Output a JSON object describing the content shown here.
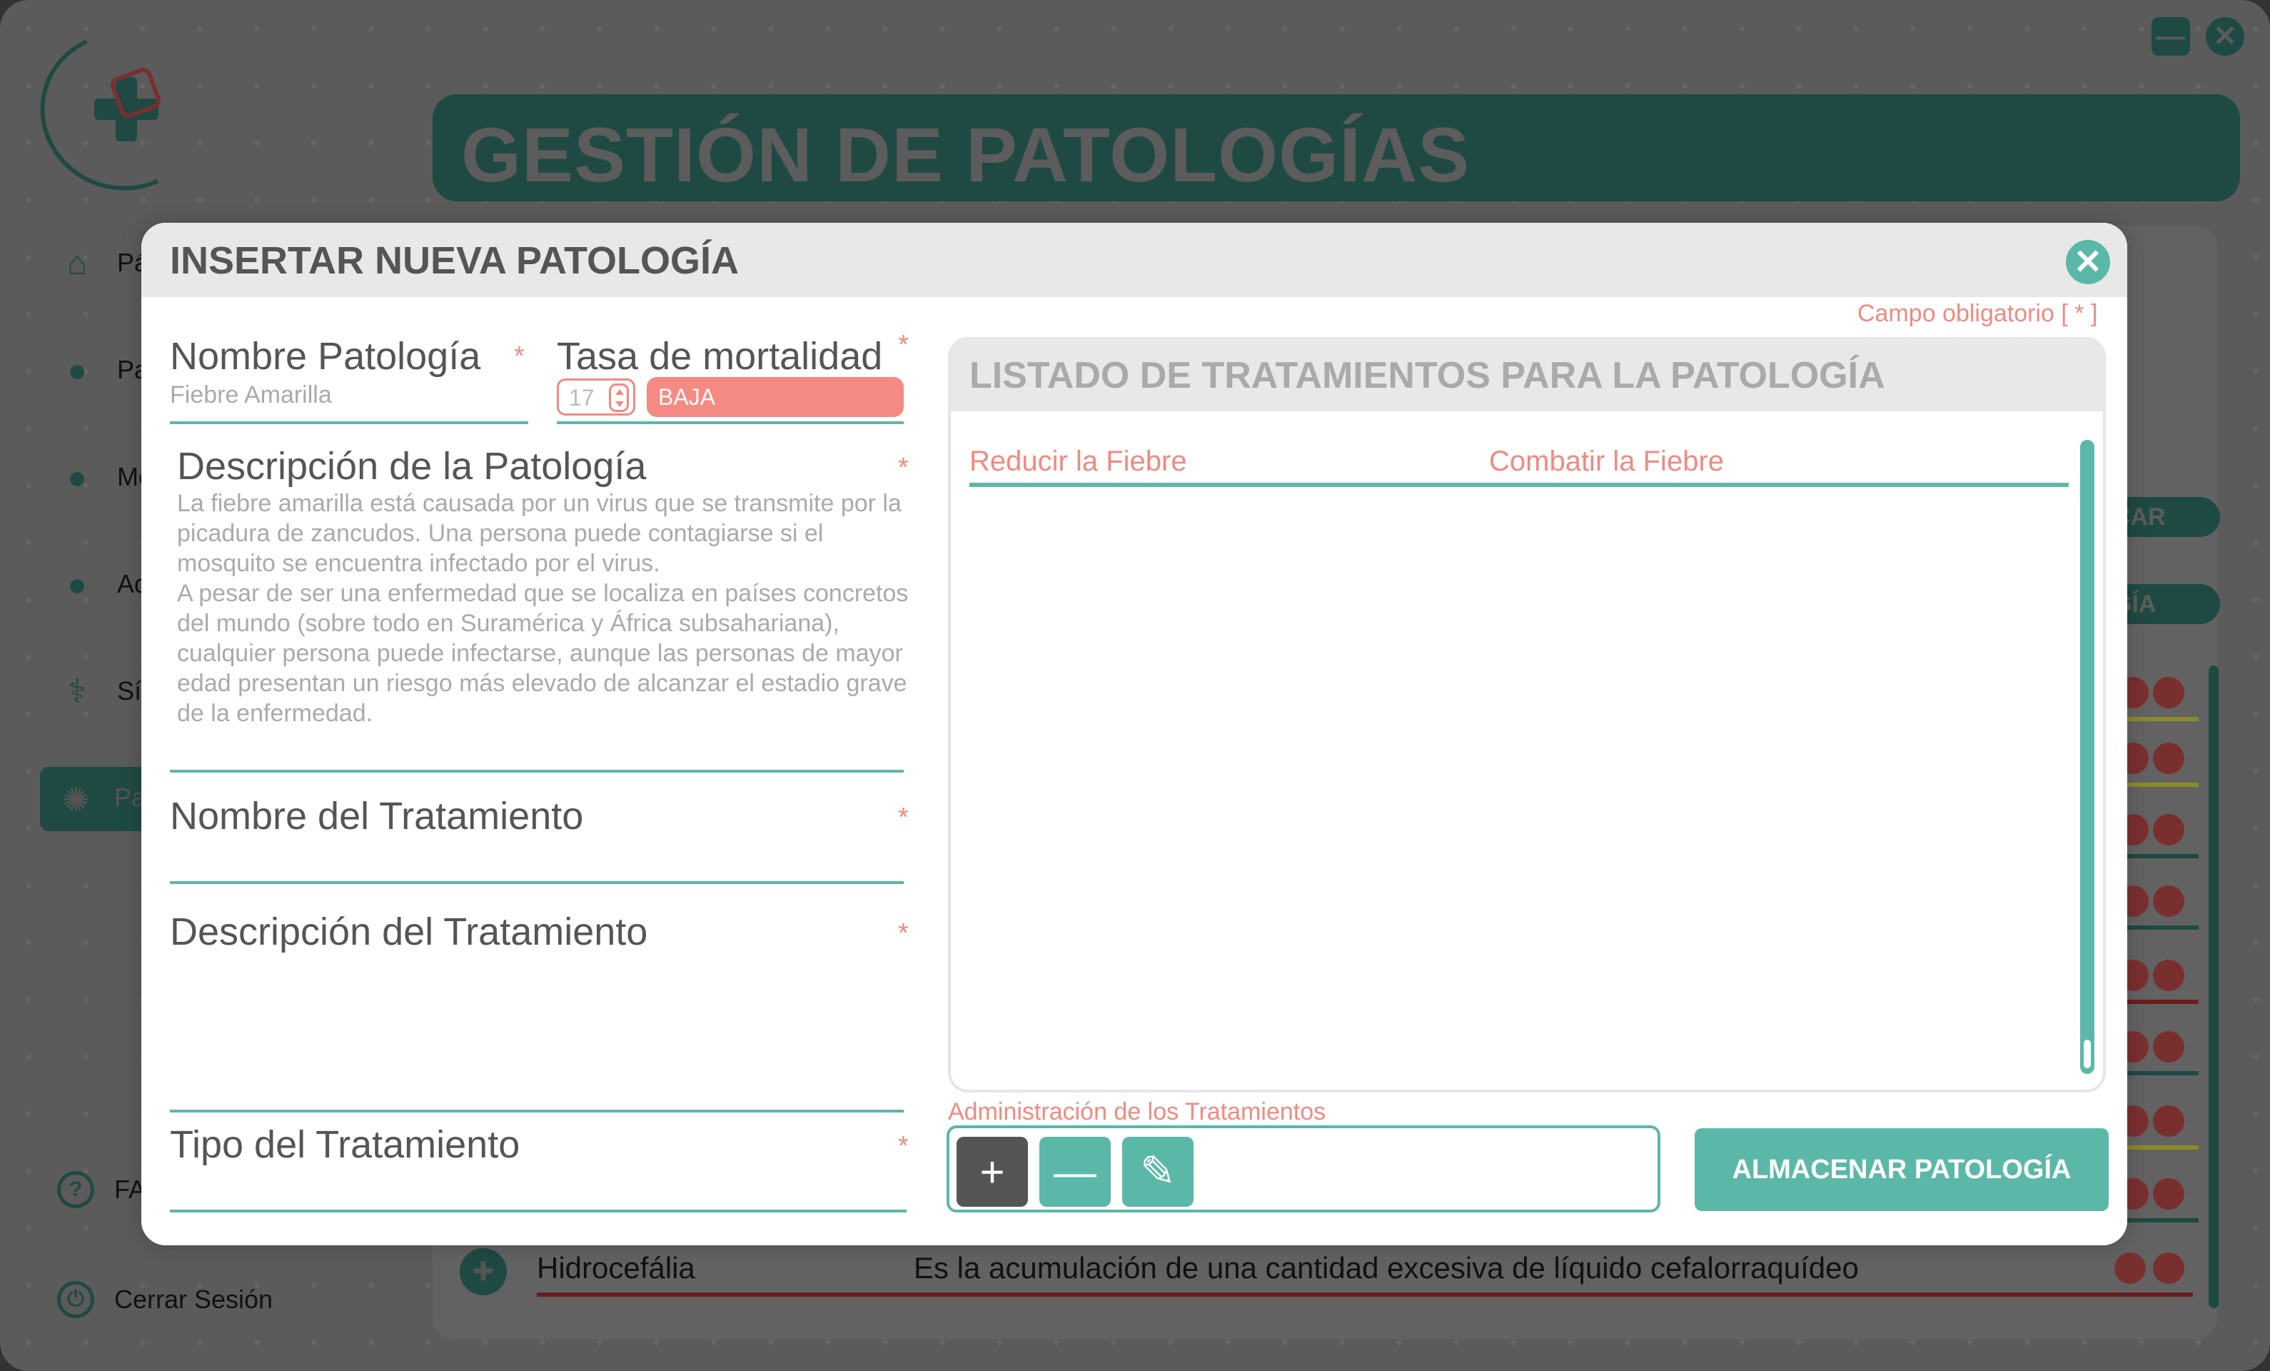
{
  "window": {
    "minimize_icon": "minimize-icon",
    "close_icon": "close-icon"
  },
  "header": {
    "title": "GESTIÓN DE PATOLOGÍAS"
  },
  "sidebar": {
    "items": [
      {
        "label": "Pá",
        "icon": "home-icon"
      },
      {
        "label": "Pa",
        "icon": "user-icon"
      },
      {
        "label": "Me",
        "icon": "user-icon"
      },
      {
        "label": "Ad",
        "icon": "user-icon"
      },
      {
        "label": "Sír",
        "icon": "symptoms-icon"
      },
      {
        "label": "Pa",
        "icon": "virus-icon"
      }
    ],
    "faq": {
      "label": "FA",
      "icon": "help-icon"
    },
    "logout": {
      "label": "Cerrar Sesión",
      "icon": "power-icon"
    }
  },
  "background": {
    "search_chip": "CAR",
    "add_chip": "GÍA",
    "visible_row": {
      "name": "Hidrocefália",
      "description": "Es la acumulación de una cantidad excesiva de líquido cefalorraquídeo"
    }
  },
  "modal": {
    "title": "INSERTAR NUEVA PATOLOGÍA",
    "required_note": "Campo obligatorio [ * ]",
    "star": "*",
    "name": {
      "label": "Nombre Patología",
      "value": "Fiebre Amarilla"
    },
    "mortality": {
      "label": "Tasa de mortalidad",
      "value": "17",
      "level": "BAJA"
    },
    "description": {
      "label": "Descripción de la Patología",
      "value": "La fiebre amarilla está causada por un virus que se transmite por la picadura de zancudos. Una persona puede contagiarse si el mosquito se encuentra infectado por el virus.\nA pesar de ser una enfermedad que se localiza en países concretos del mundo (sobre todo en Suramérica y África subsahariana), cualquier persona puede infectarse, aunque las personas de mayor edad presentan un riesgo más elevado de alcanzar el estadio grave de la enfermedad."
    },
    "treatment_name": {
      "label": "Nombre del Tratamiento"
    },
    "treatment_description": {
      "label": "Descripción del Tratamiento"
    },
    "treatment_type": {
      "label": "Tipo del Tratamiento"
    },
    "treatment_list": {
      "title": "LISTADO DE TRATAMIENTOS PARA LA PATOLOGÍA",
      "rows": [
        {
          "name": "Reducir la Fiebre",
          "description": "Combatir la Fiebre"
        }
      ]
    },
    "admin": {
      "label": "Administración de los Tratamientos",
      "add": "+",
      "remove": "—",
      "edit": "✎"
    },
    "store_button": "ALMACENAR PATOLOGÍA",
    "close": "✕"
  },
  "colors": {
    "accent": "#5bb8a8",
    "required": "#f08a80",
    "dark_green": "#1f4a43"
  }
}
